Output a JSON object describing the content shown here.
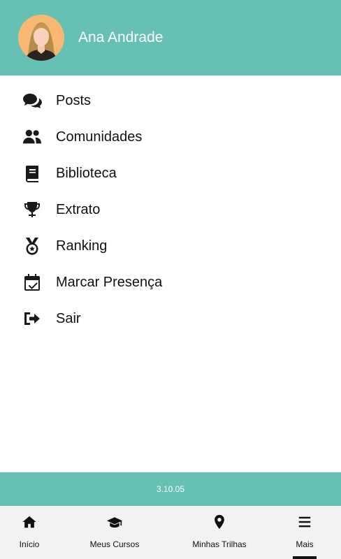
{
  "header": {
    "user_name": "Ana Andrade",
    "background_color": "#66c0b4"
  },
  "menu": {
    "items": [
      {
        "label": "Posts",
        "icon": "comments-icon"
      },
      {
        "label": "Comunidades",
        "icon": "users-icon"
      },
      {
        "label": "Biblioteca",
        "icon": "book-icon"
      },
      {
        "label": "Extrato",
        "icon": "trophy-icon"
      },
      {
        "label": "Ranking",
        "icon": "medal-icon"
      },
      {
        "label": "Marcar Presença",
        "icon": "calendar-check-icon"
      },
      {
        "label": "Sair",
        "icon": "sign-out-icon"
      }
    ]
  },
  "footer": {
    "version": "3.10.05"
  },
  "bottom_nav": {
    "items": [
      {
        "label": "Início",
        "icon": "home-icon"
      },
      {
        "label": "Meus Cursos",
        "icon": "graduation-cap-icon"
      },
      {
        "label": "Minhas Trilhas",
        "icon": "map-marker-icon"
      },
      {
        "label": "Mais",
        "icon": "menu-icon",
        "active": true
      }
    ]
  }
}
